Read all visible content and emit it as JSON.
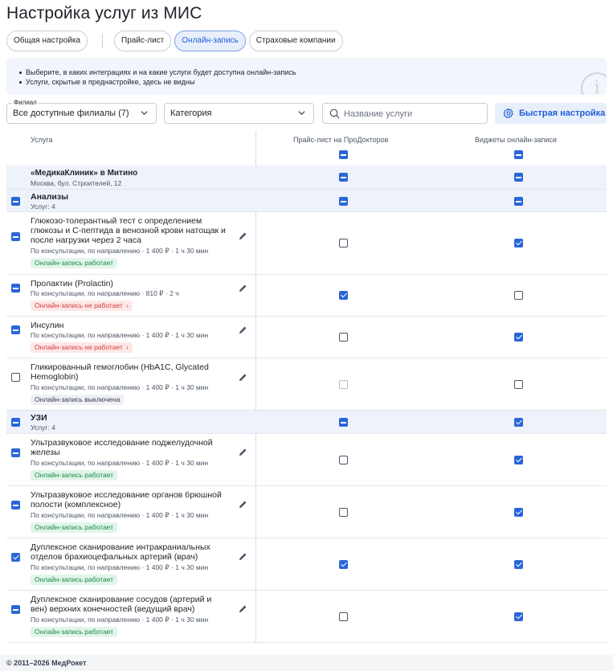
{
  "page_title": "Настройка услуг из МИС",
  "tabs": [
    {
      "label": "Общая настройка",
      "active": false
    },
    {
      "label": "Прайс-лист",
      "active": false
    },
    {
      "label": "Онлайн-запись",
      "active": true
    },
    {
      "label": "Страховые компании",
      "active": false
    }
  ],
  "info": {
    "lines": [
      "Выберите, в каких интеграциях и на какие услуги будет доступна онлайн-запись",
      "Услуги, скрытые в преднастройке, здесь не видны"
    ],
    "icon": "info-icon"
  },
  "filters": {
    "branch_legend": "Филиал",
    "branch_value": "Все доступные филиалы (7)",
    "category_value": "Категория",
    "search_placeholder": "Название услуги",
    "quick_button": "Быстрая настройка"
  },
  "table": {
    "headers": {
      "service": "Услуга",
      "price": "Прайс-лист на ПроДокторов",
      "widget": "Виджеты онлайн-записи"
    },
    "header_checks": {
      "price": "minus",
      "widget": "minus"
    },
    "clinic": {
      "name": "«МедикаКлиник» в Митино",
      "address": "Москва, бул. Строителей, 12",
      "price": "minus",
      "widget": "minus"
    },
    "groups": [
      {
        "name": "Анализы",
        "count": "Услуг: 4",
        "left": "minus",
        "price": "minus",
        "widget": "minus",
        "services": [
          {
            "name": "Глюкозо-толерантный тест с определением глюкозы и С-пептида в венозной крови натощак и после нагрузки через 2 часа",
            "meta": "По консультации, по направлению · 1 400 ₽ · 1 ч 30 мин",
            "status": "Онлайн-запись работает",
            "status_kind": "ok",
            "left": "minus",
            "price": "off",
            "widget": "check"
          },
          {
            "name": "Пролактин (Prolactin)",
            "meta": "По консультации, по направлению · 810 ₽ · 2 ч",
            "status": "Онлайн-запись не работает",
            "status_kind": "bad",
            "left": "minus",
            "price": "check",
            "widget": "off"
          },
          {
            "name": "Инсулин",
            "meta": "По консультации, по направлению · 1 400 ₽ · 1 ч 30 мин",
            "status": "Онлайн-запись не работает",
            "status_kind": "bad",
            "left": "minus",
            "price": "off",
            "widget": "check"
          },
          {
            "name": "Гликированный гемоглобин (HbA1C, Glycated Hemoglobin)",
            "meta": "По консультации, по направлению · 1 400 ₽ · 1 ч 30 мин",
            "status": "Онлайн-запись выключена",
            "status_kind": "offb",
            "left": "off",
            "price": "dis",
            "widget": "off"
          }
        ]
      },
      {
        "name": "УЗИ",
        "count": "Услуг: 4",
        "left": "minus",
        "price": "minus",
        "widget": "check",
        "services": [
          {
            "name": "Ультразвуковое исследование поджелудочной железы",
            "meta": "По консультации, по направлению · 1 400 ₽ · 1 ч 30 мин",
            "status": "Онлайн-запись работает",
            "status_kind": "ok",
            "left": "minus",
            "price": "off",
            "widget": "check"
          },
          {
            "name": "Ультразвуковое исследование органов брюшной полости (комплексное)",
            "meta": "По консультации, по направлению · 1 400 ₽ · 1 ч 30 мин",
            "status": "Онлайн-запись работает",
            "status_kind": "ok",
            "left": "minus",
            "price": "off",
            "widget": "check"
          },
          {
            "name": "Дуплексное сканирование интракраниальных отделов брахиоцефальных артерий (врач)",
            "meta": "По консультации, по направлению · 1 400 ₽ · 1 ч 30 мин",
            "status": "Онлайн-запись работает",
            "status_kind": "ok",
            "left": "check",
            "price": "check",
            "widget": "check"
          },
          {
            "name": "Дуплексное сканирование сосудов (артерий и вен) верхних конечностей (ведущий врач)",
            "meta": "По консультации, по направлению · 1 400 ₽ · 1 ч 30 мин",
            "status": "Онлайн-запись работает",
            "status_kind": "ok",
            "left": "minus",
            "price": "off",
            "widget": "check"
          }
        ]
      }
    ]
  },
  "footer": "© 2011–2026 МедРокет",
  "colors": {
    "accent": "#2a66d9",
    "ok": "#1a8a4a",
    "bad": "#d93a3a",
    "shade": "#eef2fa"
  }
}
